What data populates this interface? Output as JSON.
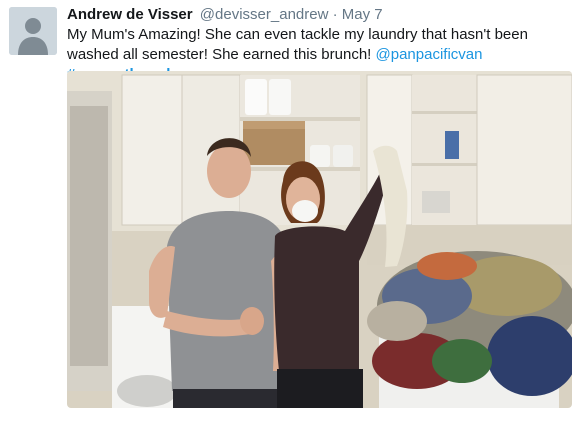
{
  "tweet": {
    "author_name": "Andrew de Visser",
    "author_handle": "@devisser_andrew",
    "separator": "·",
    "date": "May 7",
    "text_part1": "My Mum's Amazing! She can even tackle my laundry that hasn't been washed all semester! She earned this brunch! ",
    "mention": "@panpacificvan",
    "hashtag": "#panmothersday",
    "avatar_icon": "default-profile-silhouette-icon"
  },
  "colors": {
    "link": "#1b95e0",
    "meta": "#657786",
    "text": "#14171a",
    "avatar_bg": "#ccd6dd"
  }
}
